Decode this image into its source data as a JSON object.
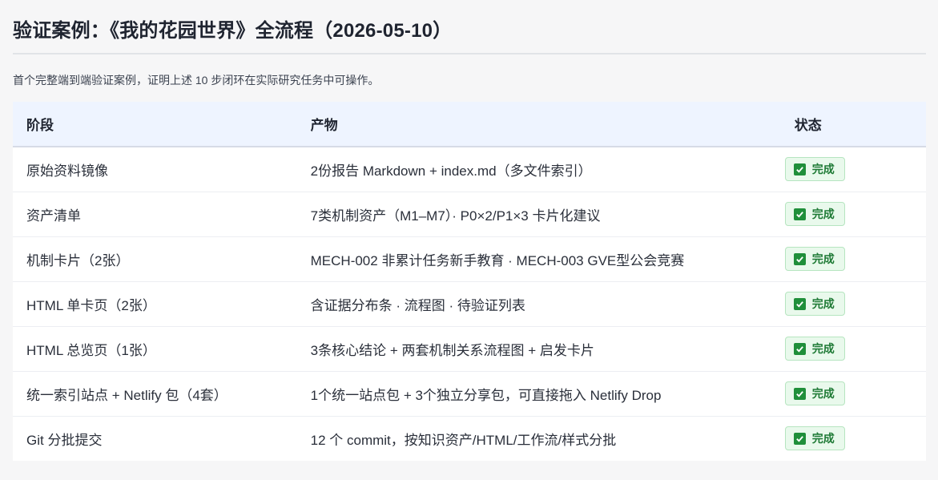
{
  "page": {
    "title": "验证案例：《我的花园世界》全流程（2026-05-10）",
    "subtitle": "首个完整端到端验证案例，证明上述 10 步闭环在实际研究任务中可操作。"
  },
  "table": {
    "headers": [
      "阶段",
      "产物",
      "状态"
    ],
    "rows": [
      {
        "stage": "原始资料镜像",
        "output": "2份报告 Markdown + index.md（多文件索引）",
        "status": "完成"
      },
      {
        "stage": "资产清单",
        "output": "7类机制资产（M1–M7）· P0×2/P1×3 卡片化建议",
        "status": "完成"
      },
      {
        "stage": "机制卡片（2张）",
        "output": "MECH-002 非累计任务新手教育 · MECH-003 GVE型公会竞赛",
        "status": "完成"
      },
      {
        "stage": "HTML 单卡页（2张）",
        "output": "含证据分布条 · 流程图 · 待验证列表",
        "status": "完成"
      },
      {
        "stage": "HTML 总览页（1张）",
        "output": "3条核心结论 + 两套机制关系流程图 + 启发卡片",
        "status": "完成"
      },
      {
        "stage": "统一索引站点 + Netlify 包（4套）",
        "output": "1个统一站点包 + 3个独立分享包，可直接拖入 Netlify Drop",
        "status": "完成"
      },
      {
        "stage": "Git 分批提交",
        "output": "12 个 commit，按知识资产/HTML/工作流/样式分批",
        "status": "完成"
      }
    ]
  },
  "icons": {
    "status": "check-mark-icon"
  },
  "colors": {
    "success": "#1f8f3a",
    "header_bg": "#eef4ff"
  }
}
